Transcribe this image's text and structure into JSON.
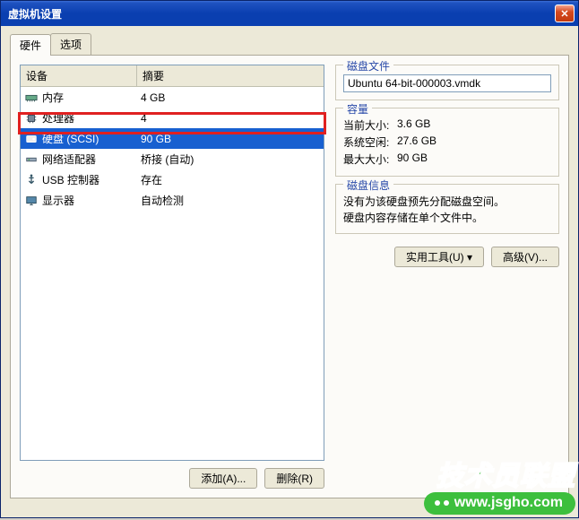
{
  "window": {
    "title": "虚拟机设置"
  },
  "tabs": {
    "hardware": "硬件",
    "options": "选项"
  },
  "columns": {
    "device": "设备",
    "summary": "摘要"
  },
  "devices": {
    "memory_label": "内存",
    "memory_value": "4 GB",
    "cpu_label": "处理器",
    "cpu_value": "4",
    "disk_label": "硬盘 (SCSI)",
    "disk_value": "90 GB",
    "net_label": "网络适配器",
    "net_value": "桥接 (自动)",
    "usb_label": "USB 控制器",
    "usb_value": "存在",
    "display_label": "显示器",
    "display_value": "自动检测"
  },
  "buttons": {
    "add": "添加(A)...",
    "remove": "删除(R)",
    "utilities": "实用工具(U)",
    "advanced": "高级(V)..."
  },
  "disk_file": {
    "title": "磁盘文件",
    "value": "Ubuntu 64-bit-000003.vmdk"
  },
  "capacity": {
    "title": "容量",
    "current_label": "当前大小:",
    "current_value": "3.6 GB",
    "free_label": "系统空闲:",
    "free_value": "27.6 GB",
    "max_label": "最大大小:",
    "max_value": "90 GB"
  },
  "disk_info": {
    "title": "磁盘信息",
    "line1": "没有为该硬盘预先分配磁盘空间。",
    "line2": "硬盘内容存储在单个文件中。"
  },
  "watermark": {
    "title": "技术员联盟",
    "url": "www.jsgho.com"
  }
}
